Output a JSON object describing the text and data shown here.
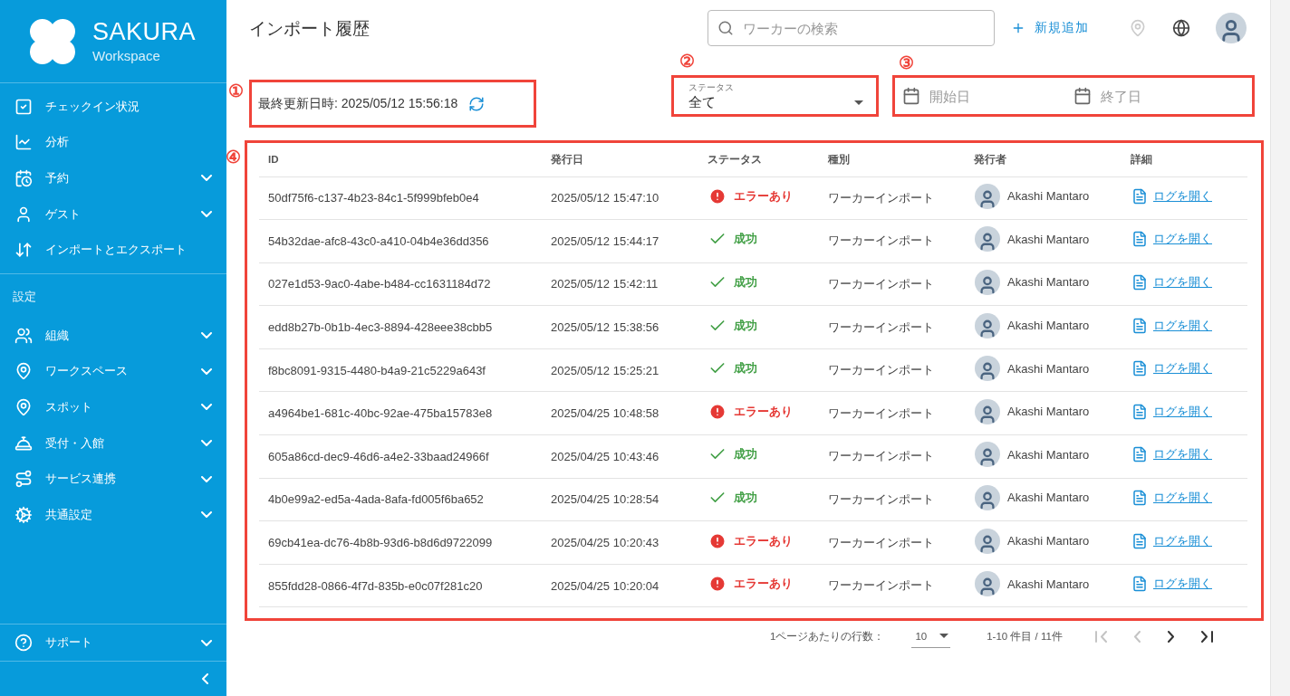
{
  "sidebar": {
    "logo": {
      "title": "SAKURA",
      "subtitle": "Workspace"
    },
    "nav_items": [
      {
        "label": "チェックイン状況",
        "expandable": false
      },
      {
        "label": "分析",
        "expandable": false
      },
      {
        "label": "予約",
        "expandable": true
      },
      {
        "label": "ゲスト",
        "expandable": true
      },
      {
        "label": "インポートとエクスポート",
        "expandable": false
      }
    ],
    "section_label": "設定",
    "settings_items": [
      {
        "label": "組織",
        "expandable": true
      },
      {
        "label": "ワークスペース",
        "expandable": true
      },
      {
        "label": "スポット",
        "expandable": true
      },
      {
        "label": "受付・入館",
        "expandable": true
      },
      {
        "label": "サービス連携",
        "expandable": true
      },
      {
        "label": "共通設定",
        "expandable": true
      }
    ],
    "support_item": {
      "label": "サポート",
      "expandable": true
    }
  },
  "header": {
    "title": "インポート履歴",
    "search": {
      "placeholder": "ワーカーの検索"
    },
    "add_button": "新規追加"
  },
  "annotations": [
    "①",
    "②",
    "③",
    "④"
  ],
  "last_updated": "最終更新日時: 2025/05/12 15:56:18",
  "status_filter": {
    "label": "ステータス",
    "value": "全て"
  },
  "date_range": {
    "start_placeholder": "開始日",
    "end_placeholder": "終了日"
  },
  "table": {
    "columns": [
      "ID",
      "発行日",
      "ステータス",
      "種別",
      "発行者",
      "詳細"
    ],
    "rows": [
      {
        "id": "50df75f6-c137-4b23-84c1-5f999bfeb0e4",
        "date": "2025/05/12 15:47:10",
        "status": {
          "kind": "error",
          "label": "エラーあり"
        },
        "type": "ワーカーインポート",
        "issuer": "Akashi Mantaro",
        "link": "ログを開く"
      },
      {
        "id": "54b32dae-afc8-43c0-a410-04b4e36dd356",
        "date": "2025/05/12 15:44:17",
        "status": {
          "kind": "success",
          "label": "成功"
        },
        "type": "ワーカーインポート",
        "issuer": "Akashi Mantaro",
        "link": "ログを開く"
      },
      {
        "id": "027e1d53-9ac0-4abe-b484-cc1631184d72",
        "date": "2025/05/12 15:42:11",
        "status": {
          "kind": "success",
          "label": "成功"
        },
        "type": "ワーカーインポート",
        "issuer": "Akashi Mantaro",
        "link": "ログを開く"
      },
      {
        "id": "edd8b27b-0b1b-4ec3-8894-428eee38cbb5",
        "date": "2025/05/12 15:38:56",
        "status": {
          "kind": "success",
          "label": "成功"
        },
        "type": "ワーカーインポート",
        "issuer": "Akashi Mantaro",
        "link": "ログを開く"
      },
      {
        "id": "f8bc8091-9315-4480-b4a9-21c5229a643f",
        "date": "2025/05/12 15:25:21",
        "status": {
          "kind": "success",
          "label": "成功"
        },
        "type": "ワーカーインポート",
        "issuer": "Akashi Mantaro",
        "link": "ログを開く"
      },
      {
        "id": "a4964be1-681c-40bc-92ae-475ba15783e8",
        "date": "2025/04/25 10:48:58",
        "status": {
          "kind": "error",
          "label": "エラーあり"
        },
        "type": "ワーカーインポート",
        "issuer": "Akashi Mantaro",
        "link": "ログを開く"
      },
      {
        "id": "605a86cd-dec9-46d6-a4e2-33baad24966f",
        "date": "2025/04/25 10:43:46",
        "status": {
          "kind": "success",
          "label": "成功"
        },
        "type": "ワーカーインポート",
        "issuer": "Akashi Mantaro",
        "link": "ログを開く"
      },
      {
        "id": "4b0e99a2-ed5a-4ada-8afa-fd005f6ba652",
        "date": "2025/04/25 10:28:54",
        "status": {
          "kind": "success",
          "label": "成功"
        },
        "type": "ワーカーインポート",
        "issuer": "Akashi Mantaro",
        "link": "ログを開く"
      },
      {
        "id": "69cb41ea-dc76-4b8b-93d6-b8d6d9722099",
        "date": "2025/04/25 10:20:43",
        "status": {
          "kind": "error",
          "label": "エラーあり"
        },
        "type": "ワーカーインポート",
        "issuer": "Akashi Mantaro",
        "link": "ログを開く"
      },
      {
        "id": "855fdd28-0866-4f7d-835b-e0c07f281c20",
        "date": "2025/04/25 10:20:04",
        "status": {
          "kind": "error",
          "label": "エラーあり"
        },
        "type": "ワーカーインポート",
        "issuer": "Akashi Mantaro",
        "link": "ログを開く"
      }
    ]
  },
  "pagination": {
    "rows_per_page_label": "1ページあたりの行数：",
    "rows_per_page": "10",
    "range": "1-10 件目 / 11件",
    "buttons": [
      {
        "kind": "first",
        "disabled": true
      },
      {
        "kind": "prev",
        "disabled": true
      },
      {
        "kind": "next",
        "disabled": false
      },
      {
        "kind": "last",
        "disabled": false
      }
    ]
  }
}
